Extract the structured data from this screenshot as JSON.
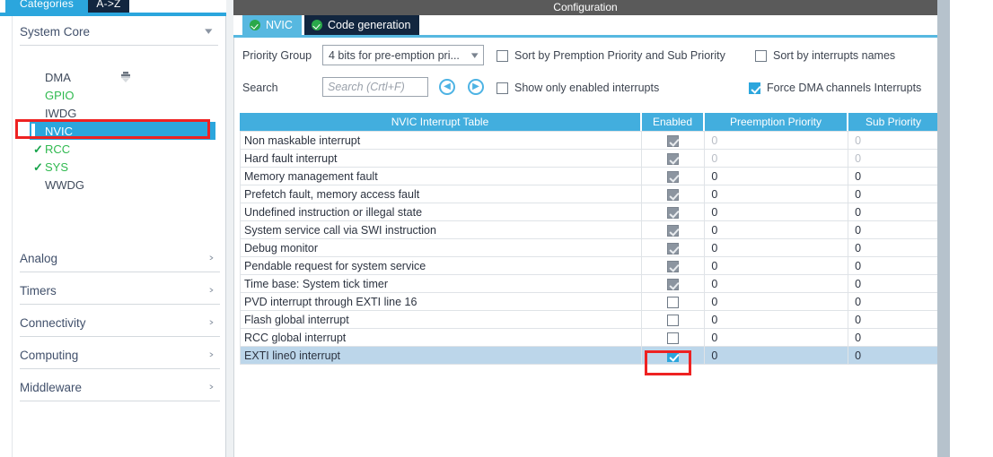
{
  "sidebar": {
    "tabs": [
      {
        "label": "Categories",
        "active": true
      },
      {
        "label": "A->Z",
        "active": false
      }
    ],
    "system_core": {
      "title": "System Core",
      "chevron_icon": "chevron-down-icon",
      "scroll_indicator_icon": "scroll-up-icon",
      "items": [
        {
          "label": "DMA",
          "state": "normal",
          "checked": false
        },
        {
          "label": "GPIO",
          "state": "green",
          "checked": false
        },
        {
          "label": "IWDG",
          "state": "normal",
          "checked": false
        },
        {
          "label": "NVIC",
          "state": "selected",
          "checked": false
        },
        {
          "label": "RCC",
          "state": "green",
          "checked": true
        },
        {
          "label": "SYS",
          "state": "green",
          "checked": true
        },
        {
          "label": "WWDG",
          "state": "normal",
          "checked": false
        }
      ]
    },
    "groups": [
      {
        "label": "Analog",
        "chevron_icon": "chevron-right-icon"
      },
      {
        "label": "Timers",
        "chevron_icon": "chevron-right-icon"
      },
      {
        "label": "Connectivity",
        "chevron_icon": "chevron-right-icon"
      },
      {
        "label": "Computing",
        "chevron_icon": "chevron-right-icon"
      },
      {
        "label": "Middleware",
        "chevron_icon": "chevron-right-icon"
      }
    ]
  },
  "main": {
    "window_title": "Configuration",
    "tabs": [
      {
        "label": "NVIC",
        "status_icon": "green-check-icon",
        "active": true
      },
      {
        "label": "Code generation",
        "status_icon": "green-check-icon",
        "active": false
      }
    ],
    "priority_group": {
      "label": "Priority Group",
      "value": "4 bits for pre-emption pri...",
      "caret_icon": "chevron-down-icon"
    },
    "search": {
      "label": "Search",
      "value": "",
      "placeholder": "Search (Crtl+F)",
      "prev_icon": "circle-left-arrow-icon",
      "next_icon": "circle-right-arrow-icon"
    },
    "checkboxes": [
      {
        "label": "Sort by Premption Priority and Sub Priority",
        "checked": false
      },
      {
        "label": "Sort by interrupts names",
        "checked": false
      },
      {
        "label": "Show only enabled interrupts",
        "checked": false
      },
      {
        "label": "Force DMA channels Interrupts",
        "checked": true
      }
    ],
    "table": {
      "columns": [
        "NVIC Interrupt Table",
        "Enabled",
        "Preemption Priority",
        "Sub Priority"
      ],
      "rows": [
        {
          "name": "Non maskable interrupt",
          "enabled": true,
          "enabled_state": "locked",
          "preemption": "0",
          "sub": "0",
          "dim": true,
          "selected": false
        },
        {
          "name": "Hard fault interrupt",
          "enabled": true,
          "enabled_state": "locked",
          "preemption": "0",
          "sub": "0",
          "dim": true,
          "selected": false
        },
        {
          "name": "Memory management fault",
          "enabled": true,
          "enabled_state": "locked",
          "preemption": "0",
          "sub": "0",
          "dim": false,
          "selected": false
        },
        {
          "name": "Prefetch fault, memory access fault",
          "enabled": true,
          "enabled_state": "locked",
          "preemption": "0",
          "sub": "0",
          "dim": false,
          "selected": false
        },
        {
          "name": "Undefined instruction or illegal state",
          "enabled": true,
          "enabled_state": "locked",
          "preemption": "0",
          "sub": "0",
          "dim": false,
          "selected": false
        },
        {
          "name": "System service call via SWI instruction",
          "enabled": true,
          "enabled_state": "locked",
          "preemption": "0",
          "sub": "0",
          "dim": false,
          "selected": false
        },
        {
          "name": "Debug monitor",
          "enabled": true,
          "enabled_state": "locked",
          "preemption": "0",
          "sub": "0",
          "dim": false,
          "selected": false
        },
        {
          "name": "Pendable request for system service",
          "enabled": true,
          "enabled_state": "locked",
          "preemption": "0",
          "sub": "0",
          "dim": false,
          "selected": false
        },
        {
          "name": "Time base: System tick timer",
          "enabled": true,
          "enabled_state": "locked",
          "preemption": "0",
          "sub": "0",
          "dim": false,
          "selected": false
        },
        {
          "name": "PVD interrupt through EXTI line 16",
          "enabled": false,
          "enabled_state": "unchecked",
          "preemption": "0",
          "sub": "0",
          "dim": false,
          "selected": false
        },
        {
          "name": "Flash global interrupt",
          "enabled": false,
          "enabled_state": "unchecked",
          "preemption": "0",
          "sub": "0",
          "dim": false,
          "selected": false
        },
        {
          "name": "RCC global interrupt",
          "enabled": false,
          "enabled_state": "unchecked",
          "preemption": "0",
          "sub": "0",
          "dim": false,
          "selected": false
        },
        {
          "name": "EXTI line0 interrupt",
          "enabled": true,
          "enabled_state": "checked",
          "preemption": "0",
          "sub": "0",
          "dim": false,
          "selected": true
        }
      ]
    }
  },
  "annotations": [
    {
      "name": "nvic-sidebar-highlight",
      "color": "#ee2222"
    },
    {
      "name": "exti-enabled-highlight",
      "color": "#ee2222"
    }
  ]
}
